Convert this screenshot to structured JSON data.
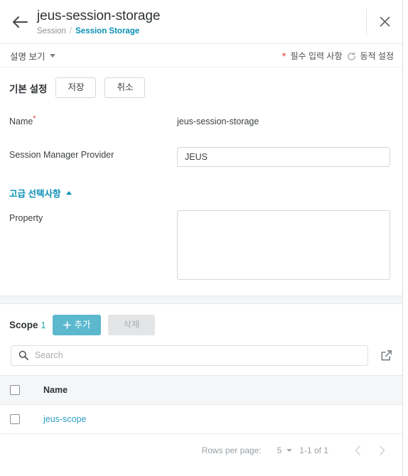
{
  "header": {
    "back_icon": "arrow-left-icon",
    "title": "jeus-session-storage",
    "breadcrumb_parent": "Session",
    "breadcrumb_sep": "/",
    "breadcrumb_current": "Session Storage",
    "close_icon": "close-icon",
    "accent_color": "#0a8fb5"
  },
  "toolbar": {
    "description_toggle": "설명 보기",
    "required_marker": "*",
    "required_label": "필수 입력 사항",
    "dynamic_icon": "refresh-icon",
    "dynamic_label": "동적 설정",
    "required_color": "#e8453c"
  },
  "basic": {
    "section_title": "기본 설정",
    "save_label": "저장",
    "cancel_label": "취소",
    "fields": [
      {
        "label": "Name",
        "required": "*",
        "value": "jeus-session-storage",
        "type": "static"
      },
      {
        "label": "Session Manager Provider",
        "required": "",
        "value": "JEUS",
        "type": "input",
        "placeholder": ""
      }
    ]
  },
  "advanced": {
    "toggle_label": "고급 선택사항",
    "toggle_state": "expanded",
    "property_label": "Property",
    "property_value": "",
    "property_placeholder": ""
  },
  "scope": {
    "title": "Scope",
    "count": "1",
    "add_label": "추가",
    "add_icon": "plus-icon",
    "delete_label": "삭제",
    "delete_disabled": true,
    "primary_color": "#5bb8cd",
    "count_color": "#1aa6a6"
  },
  "search": {
    "icon": "search-icon",
    "value": "",
    "placeholder": "Search",
    "external_icon": "open-in-new-icon"
  },
  "table": {
    "select_all_checked": false,
    "columns": [
      "Name"
    ],
    "rows": [
      {
        "checked": false,
        "name": "jeus-scope"
      }
    ]
  },
  "pager": {
    "rows_per_page_label": "Rows per page:",
    "page_size": "5",
    "range_label": "1-1 of 1",
    "prev_icon": "chevron-left-icon",
    "next_icon": "chevron-right-icon"
  }
}
